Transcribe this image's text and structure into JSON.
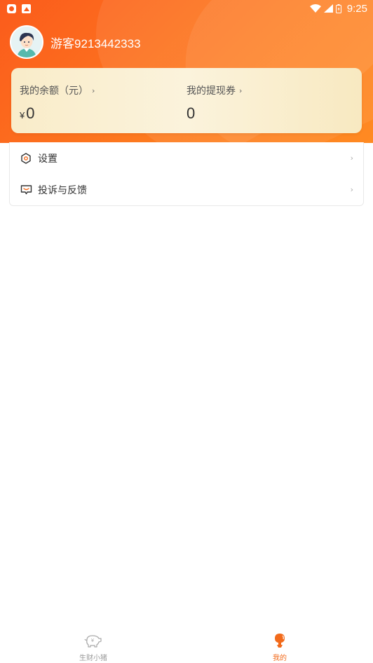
{
  "status_bar": {
    "time": "9:25"
  },
  "profile": {
    "username": "游客9213442333"
  },
  "balance": {
    "left_label": "我的余额（元）",
    "left_currency": "¥",
    "left_value": "0",
    "right_label": "我的提现券",
    "right_value": "0",
    "chevron": "›"
  },
  "menu": {
    "items": [
      {
        "label": "设置",
        "icon": "settings-icon"
      },
      {
        "label": "投诉与反馈",
        "icon": "feedback-icon"
      }
    ],
    "chevron": "›"
  },
  "tabbar": {
    "tabs": [
      {
        "label": "生财小猪",
        "icon": "piggy-bank-icon",
        "active": false
      },
      {
        "label": "我的",
        "icon": "profile-icon",
        "active": true
      }
    ]
  },
  "colors": {
    "brand_orange": "#fb5b1c",
    "accent_active": "#f26a1b",
    "card_cream": "#f9ecc9"
  }
}
